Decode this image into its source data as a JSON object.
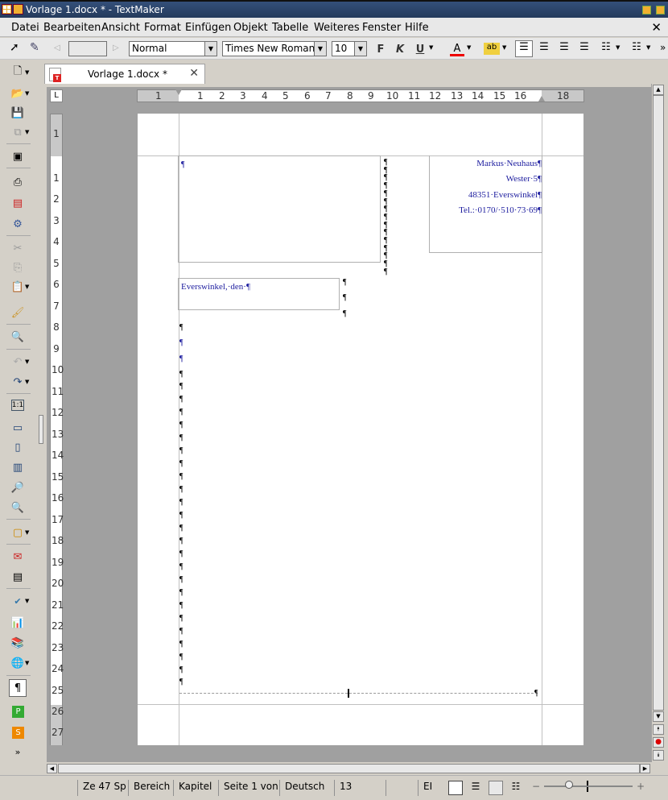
{
  "window": {
    "title": "Vorlage 1.docx * - TextMaker"
  },
  "menu": {
    "items": [
      "Datei",
      "Bearbeiten",
      "Ansicht",
      "Format",
      "Einfügen",
      "Objekt",
      "Tabelle",
      "Weiteres",
      "Fenster",
      "Hilfe"
    ],
    "close": "✕"
  },
  "toolbar": {
    "paragraph_style": "Normal",
    "font_name": "Times New Roman",
    "font_size": "10",
    "bold": "F",
    "italic": "K",
    "underline": "U",
    "font_color_label": "A",
    "highlight_label": "ab",
    "overflow": "»"
  },
  "tab": {
    "label": "Vorlage 1.docx *",
    "close": "✕"
  },
  "ruler": {
    "corner": "L",
    "horizontal_ticks": [
      "1",
      "1",
      "2",
      "3",
      "4",
      "5",
      "6",
      "7",
      "8",
      "9",
      "10",
      "11",
      "12",
      "13",
      "14",
      "15",
      "16",
      "18"
    ],
    "vertical_ticks": [
      "1",
      "1",
      "2",
      "3",
      "4",
      "5",
      "6",
      "7",
      "8",
      "9",
      "10",
      "11",
      "12",
      "13",
      "14",
      "15",
      "16",
      "17",
      "18",
      "19",
      "20",
      "21",
      "22",
      "23",
      "24",
      "25",
      "26",
      "27"
    ]
  },
  "document": {
    "sender_lines": [
      "Markus·Neuhaus¶",
      "Wester·5¶",
      "48351·Everswinkel¶",
      "Tel.:·0170/·510·73·69¶"
    ],
    "date_line": "Everswinkel,·den·¶",
    "pilcrow": "¶"
  },
  "statusbar": {
    "position": "Ze 47 Sp",
    "area": "Bereich",
    "chapter": "Kapitel",
    "page": "Seite 1 von",
    "language": "Deutsch",
    "count": "13",
    "mode": "EI",
    "zoom_minus": "−",
    "zoom_plus": "+"
  },
  "sidebar": {
    "more": "»"
  }
}
